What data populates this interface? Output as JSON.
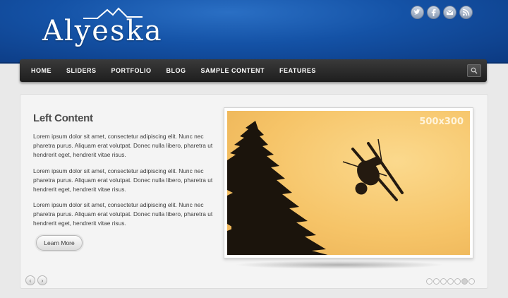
{
  "site": {
    "logo_text": "Alyeska"
  },
  "social": {
    "icons": [
      "twitter-icon",
      "facebook-icon",
      "mail-icon",
      "rss-icon"
    ]
  },
  "nav": {
    "items": [
      "HOME",
      "SLIDERS",
      "PORTFOLIO",
      "BLOG",
      "SAMPLE CONTENT",
      "FEATURES"
    ],
    "search_icon": "search-icon"
  },
  "slide": {
    "title": "Left Content",
    "paragraphs": [
      "Lorem ipsum dolor sit amet, consectetur adipiscing elit. Nunc nec pharetra purus. Aliquam erat volutpat. Donec nulla libero, pharetra ut hendrerit eget, hendrerit vitae risus.",
      "Lorem ipsum dolor sit amet, consectetur adipiscing elit. Nunc nec pharetra purus. Aliquam erat volutpat. Donec nulla libero, pharetra ut hendrerit eget, hendrerit vitae risus.",
      "Lorem ipsum dolor sit amet, consectetur adipiscing elit. Nunc nec pharetra purus. Aliquam erat volutpat. Donec nulla libero, pharetra ut hendrerit eget, hendrerit vitae risus."
    ],
    "button_label": "Learn More",
    "image_label": "500x300"
  },
  "slider": {
    "prev_label": "‹",
    "next_label": "›",
    "dot_count": 7,
    "active_dot": 5
  },
  "colors": {
    "header_blue": "#1452a6",
    "nav_dark": "#2a2a2a",
    "photo_sky": "#f6c468"
  }
}
